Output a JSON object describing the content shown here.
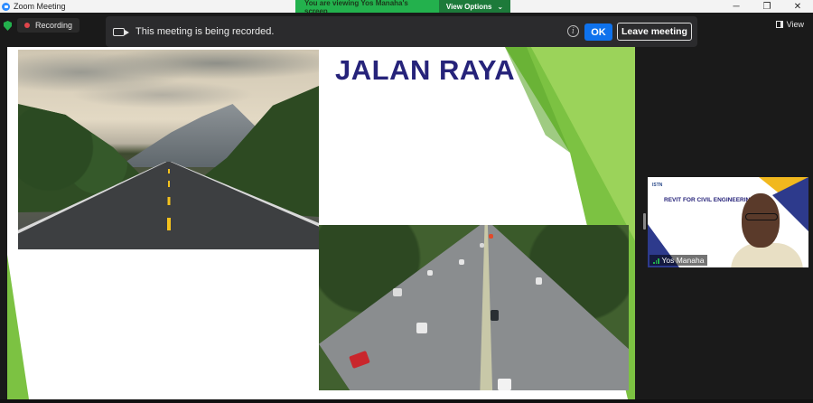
{
  "window": {
    "title": "Zoom Meeting",
    "controls": {
      "minimize": "─",
      "maximize": "❐",
      "close": "✕"
    }
  },
  "share_banner": {
    "viewing_text": "You are viewing Yos Manaha's screen",
    "view_options_label": "View Options",
    "view_options_chevron": "⌄"
  },
  "status": {
    "recording_label": "Recording",
    "view_label": "View"
  },
  "notification": {
    "message": "This meeting is being recorded.",
    "info_glyph": "i",
    "ok_label": "OK",
    "leave_label": "Leave meeting"
  },
  "slide": {
    "title": "JALAN RAYA"
  },
  "participant": {
    "name": "Yos Manaha",
    "slide_title": "REVIT FOR CIVIL ENGINEERING",
    "slide_logos": "ISTN"
  },
  "colors": {
    "accent_blue": "#0e72ed",
    "share_green": "#23b14d",
    "slide_green": "#7cc242",
    "slide_title_navy": "#26237a",
    "recording_red": "#e0454b"
  }
}
